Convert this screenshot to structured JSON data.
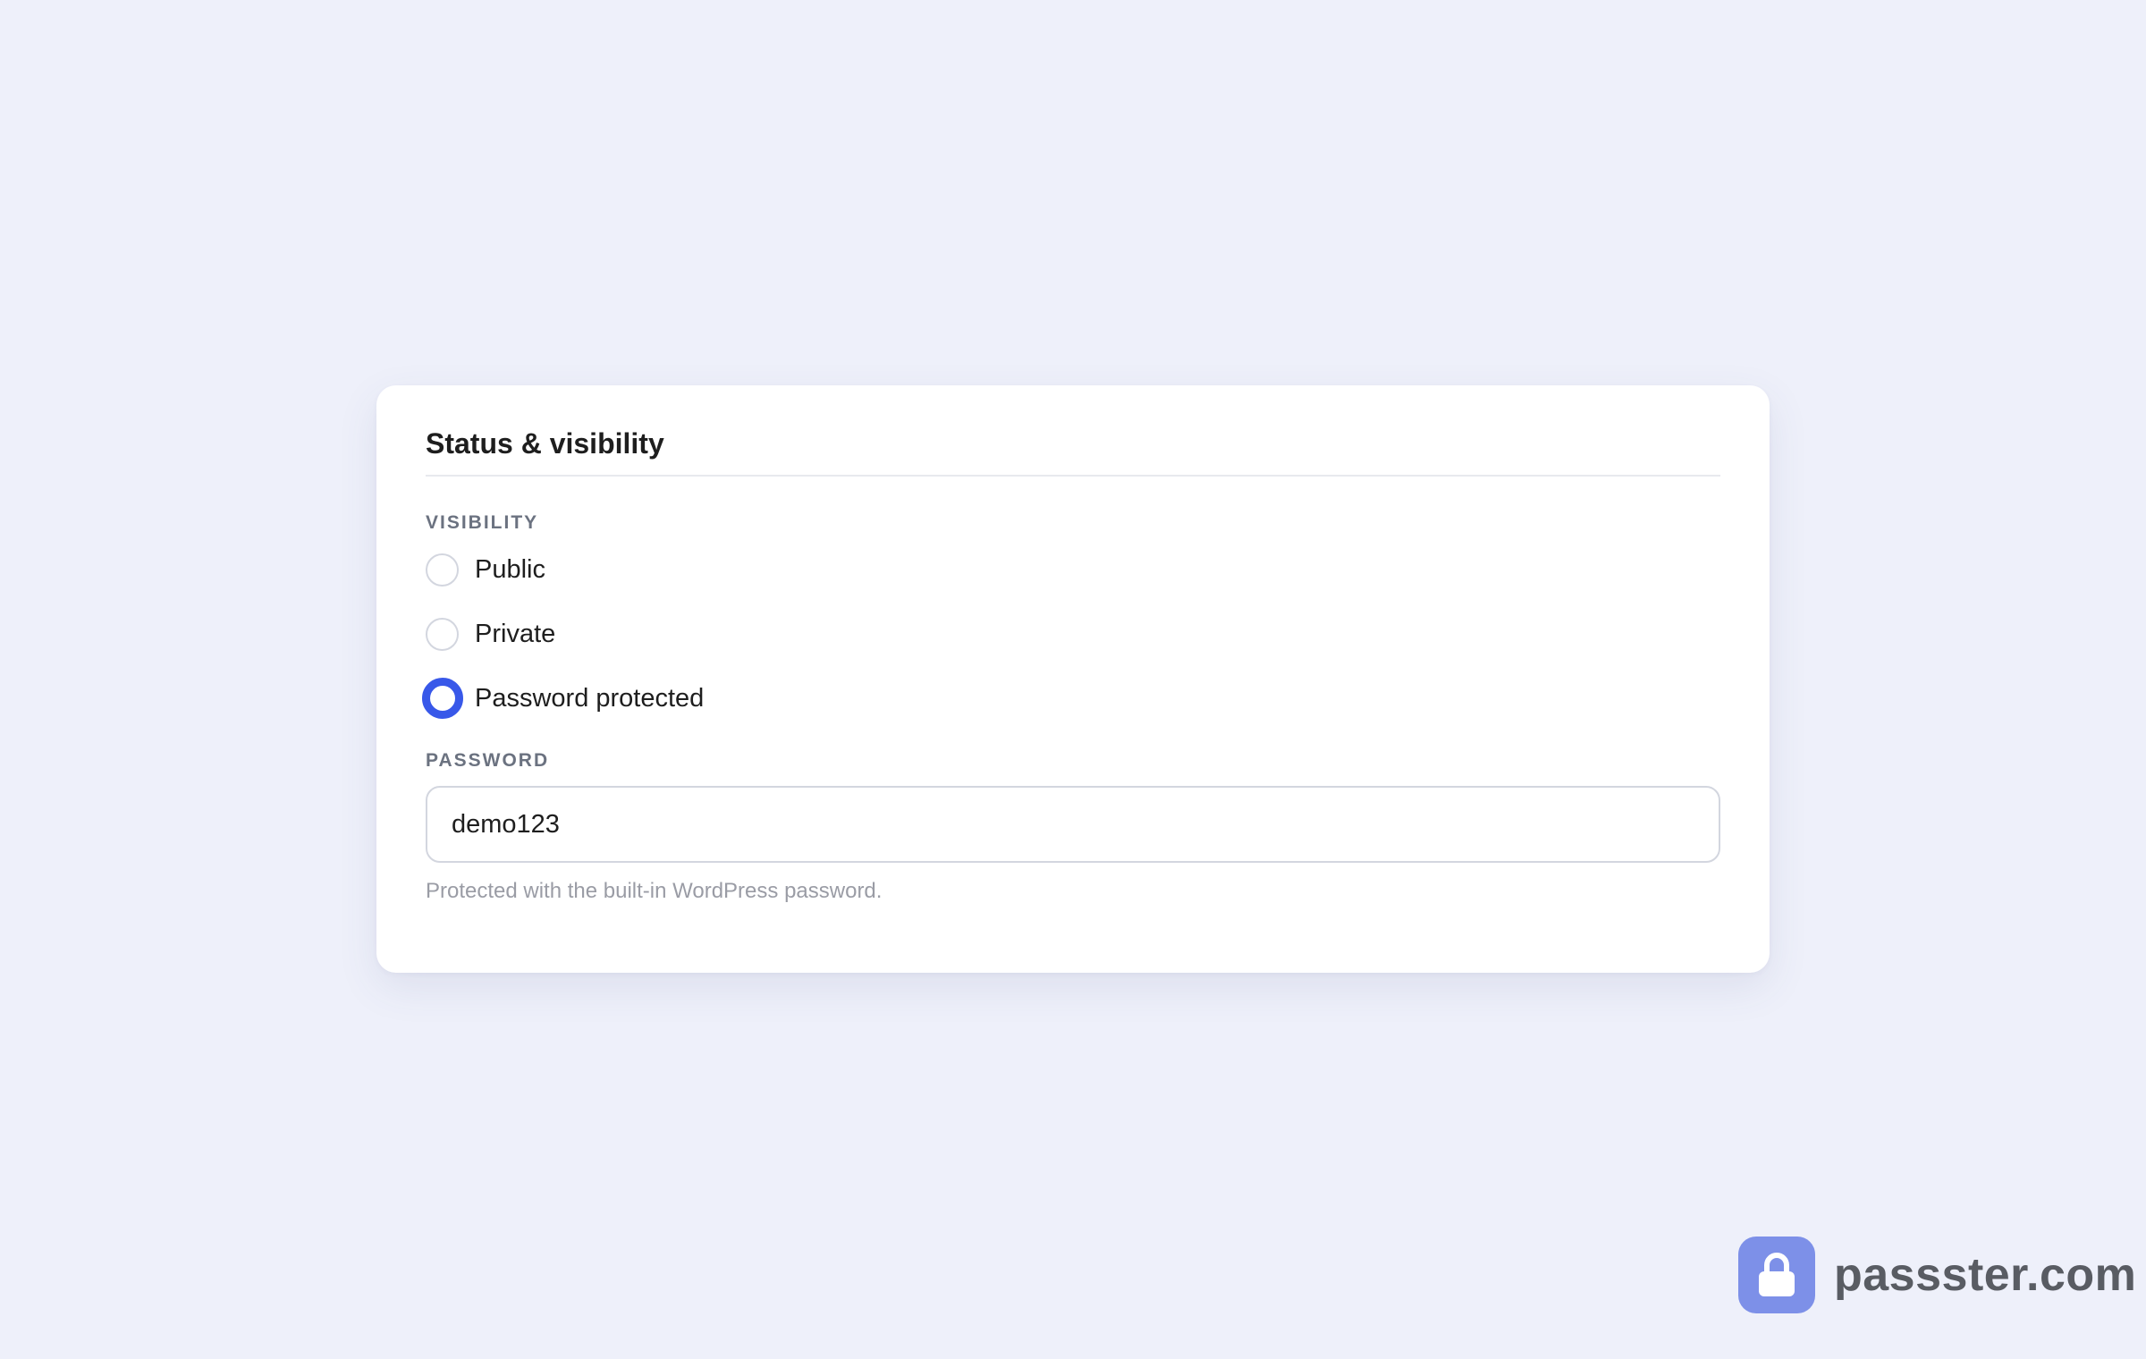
{
  "panel": {
    "title": "Status & visibility",
    "visibility_label": "VISIBILITY",
    "options": [
      {
        "label": "Public",
        "checked": false
      },
      {
        "label": "Private",
        "checked": false
      },
      {
        "label": "Password protected",
        "checked": true
      }
    ],
    "password_label": "PASSWORD",
    "password_value": "demo123",
    "help_text": "Protected with the built-in WordPress password."
  },
  "brand": {
    "text": "passster.com",
    "icon": "lock-icon"
  },
  "colors": {
    "background": "#eef0fa",
    "accent": "#3858e9",
    "brand_badge": "#7d90e8"
  }
}
